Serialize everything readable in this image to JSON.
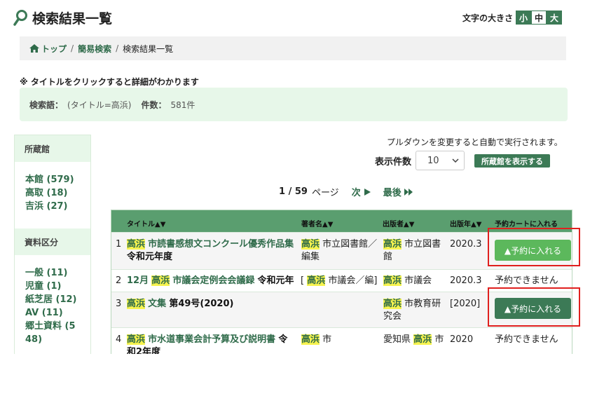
{
  "page": {
    "title": "検索結果一覧"
  },
  "font_size": {
    "label": "文字の大きさ",
    "small": "小",
    "medium": "中",
    "large": "大"
  },
  "breadcrumb": {
    "top": "トップ",
    "simple_search": "簡易検索",
    "current": "検索結果一覧",
    "sep": "/"
  },
  "notice": "※ タイトルをクリックすると詳細がわかります",
  "summary": {
    "query_label": "検索語：",
    "query_value": "(タイトル=高浜)",
    "count_label": "件数：",
    "count_value": "581件"
  },
  "sidebar": {
    "holding_title": "所蔵館",
    "holdings": [
      "本館 (579)",
      "高取 (18)",
      "吉浜 (27)"
    ],
    "category_title": "資料区分",
    "categories": [
      "一般 (11)",
      "児童 (1)",
      "紙芝居 (12)",
      "AV (11)",
      "郷土資料 (5\n48)"
    ]
  },
  "controls": {
    "hint": "プルダウンを変更すると自動で実行されます。",
    "per_page_label": "表示件数",
    "per_page_value": "10",
    "show_library_button": "所蔵館を表示する"
  },
  "pager": {
    "current": "1 / 59",
    "page_word": "ページ",
    "next": "次",
    "last": "最後"
  },
  "table": {
    "headers": {
      "title": "タイトル▲▼",
      "author": "著者名▲▼",
      "publisher": "出版者▲▼",
      "year": "出版年▲▼",
      "cart": "予約カートに入れる"
    },
    "rows": [
      {
        "num": "1",
        "t_hl": "高浜",
        "t_rest": "市読書感想文コンクール優秀作品集",
        "t_line2": "令和元年度",
        "a_hl": "高浜",
        "a_rest": "市立図書館／",
        "a_line2": "編集",
        "p_hl": "高浜",
        "p_rest": "市立図書",
        "p_line2": "館",
        "year": "2020.3",
        "action": "▲予約に入れる"
      },
      {
        "num": "2",
        "t_pre": "12月",
        "t_hl": "高浜",
        "t_rest": "市議会定例会会議録",
        "t_bold": "令和元年",
        "a_pre": "[",
        "a_hl": "高浜",
        "a_rest": "市議会／編]",
        "p_hl": "高浜",
        "p_rest": "市議会",
        "year": "2020.3",
        "action": "予約できません"
      },
      {
        "num": "3",
        "t_hl": "高浜",
        "t_rest": "文集",
        "t_bold": "第49号(2020)",
        "p_hl": "高浜",
        "p_rest": "市教育研",
        "p_line2": "究会",
        "year": "[2020]",
        "action": "▲予約に入れる"
      },
      {
        "num": "4",
        "t_hl": "高浜",
        "t_rest": "市水道事業会計予算及び説明書",
        "t_bold": "令",
        "t_line2": "和2年度",
        "a_hl": "高浜",
        "a_rest": "市",
        "p_pre": "愛知県",
        "p_hl": "高浜",
        "p_rest": "市",
        "year": "2020",
        "action": "予約できません"
      }
    ]
  }
}
